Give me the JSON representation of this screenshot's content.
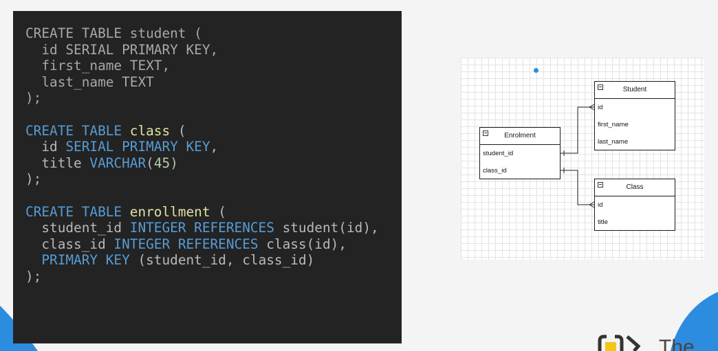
{
  "code": {
    "lines": [
      {
        "dim": true,
        "tokens": [
          {
            "t": "CREATE TABLE ",
            "c": "plain"
          },
          {
            "t": "student",
            "c": "plain"
          },
          {
            "t": " (",
            "c": "plain"
          }
        ]
      },
      {
        "dim": true,
        "tokens": [
          {
            "t": "  id SERIAL PRIMARY KEY,",
            "c": "plain"
          }
        ]
      },
      {
        "dim": true,
        "tokens": [
          {
            "t": "  first_name TEXT,",
            "c": "plain"
          }
        ]
      },
      {
        "dim": true,
        "tokens": [
          {
            "t": "  last_name TEXT",
            "c": "plain"
          }
        ]
      },
      {
        "dim": true,
        "tokens": [
          {
            "t": ");",
            "c": "plain"
          }
        ]
      },
      {
        "blank": true,
        "tokens": []
      },
      {
        "tokens": [
          {
            "t": "CREATE TABLE ",
            "c": "kw"
          },
          {
            "t": "class",
            "c": "name"
          },
          {
            "t": " (",
            "c": "plain"
          }
        ]
      },
      {
        "tokens": [
          {
            "t": "  id ",
            "c": "plain"
          },
          {
            "t": "SERIAL PRIMARY KEY",
            "c": "kw"
          },
          {
            "t": ",",
            "c": "plain"
          }
        ]
      },
      {
        "tokens": [
          {
            "t": "  title ",
            "c": "plain"
          },
          {
            "t": "VARCHAR",
            "c": "type"
          },
          {
            "t": "(",
            "c": "plain"
          },
          {
            "t": "45",
            "c": "num"
          },
          {
            "t": ")",
            "c": "plain"
          }
        ]
      },
      {
        "tokens": [
          {
            "t": ");",
            "c": "plain"
          }
        ]
      },
      {
        "blank": true,
        "tokens": []
      },
      {
        "tokens": [
          {
            "t": "CREATE TABLE ",
            "c": "kw"
          },
          {
            "t": "enrollment",
            "c": "name"
          },
          {
            "t": " (",
            "c": "plain"
          }
        ]
      },
      {
        "tokens": [
          {
            "t": "  student_id ",
            "c": "plain"
          },
          {
            "t": "INTEGER REFERENCES",
            "c": "kw"
          },
          {
            "t": " student(id),",
            "c": "plain"
          }
        ]
      },
      {
        "tokens": [
          {
            "t": "  class_id ",
            "c": "plain"
          },
          {
            "t": "INTEGER REFERENCES",
            "c": "kw"
          },
          {
            "t": " class(id),",
            "c": "plain"
          }
        ]
      },
      {
        "tokens": [
          {
            "t": "  ",
            "c": "plain"
          },
          {
            "t": "PRIMARY KEY",
            "c": "kw"
          },
          {
            "t": " (student_id, class_id)",
            "c": "plain"
          }
        ]
      },
      {
        "tokens": [
          {
            "t": ");",
            "c": "plain"
          }
        ]
      }
    ]
  },
  "diagram": {
    "entities": {
      "student": {
        "title": "Student",
        "attributes": [
          "id",
          "first_name",
          "last_name"
        ]
      },
      "enrolment": {
        "title": "Enrolment",
        "attributes": [
          "student_id",
          "class_id"
        ]
      },
      "class": {
        "title": "Class",
        "attributes": [
          "id",
          "title"
        ]
      }
    }
  },
  "colors": {
    "code_bg": "#232323",
    "keyword": "#569cd6",
    "identifier": "#e1e1a3",
    "number": "#b5cea8",
    "accent_blue": "#2b8fe6",
    "logo_yellow": "#f5c518"
  },
  "logo": {
    "text": "The"
  }
}
